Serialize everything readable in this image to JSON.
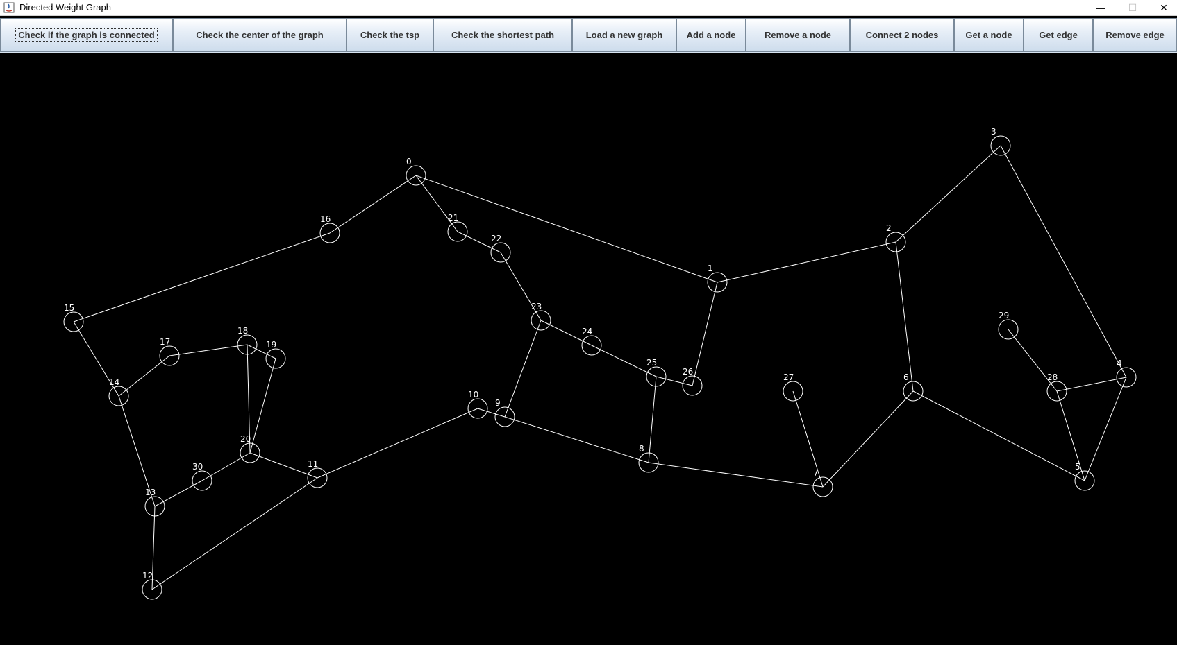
{
  "window": {
    "title": "Directed Weight Graph",
    "controls": {
      "minimize": "—",
      "maximize": "☐",
      "close": "✕"
    }
  },
  "toolbar": {
    "buttons": [
      {
        "id": "check-connected",
        "label": "Check if the graph is connected",
        "focused": true
      },
      {
        "id": "check-center",
        "label": "Check the center of the graph"
      },
      {
        "id": "check-tsp",
        "label": "Check the tsp"
      },
      {
        "id": "check-shortest-path",
        "label": "Check the shortest path"
      },
      {
        "id": "load-graph",
        "label": "Load a new graph"
      },
      {
        "id": "add-node",
        "label": "Add a node"
      },
      {
        "id": "remove-node",
        "label": "Remove a node"
      },
      {
        "id": "connect-nodes",
        "label": "Connect 2 nodes"
      },
      {
        "id": "get-node",
        "label": "Get a node"
      },
      {
        "id": "get-edge",
        "label": "Get edge"
      },
      {
        "id": "remove-edge",
        "label": "Remove edge"
      }
    ]
  },
  "graph": {
    "colors": {
      "background": "#000000",
      "stroke": "#ffffff"
    },
    "nodes": [
      "0",
      "1",
      "2",
      "3",
      "4",
      "5",
      "6",
      "7",
      "8",
      "9",
      "10",
      "11",
      "12",
      "13",
      "14",
      "15",
      "16",
      "17",
      "18",
      "19",
      "20",
      "21",
      "22",
      "23",
      "24",
      "25",
      "26",
      "27",
      "28",
      "29",
      "30"
    ],
    "edges": [
      [
        "0",
        "16"
      ],
      [
        "0",
        "21"
      ],
      [
        "0",
        "1"
      ],
      [
        "16",
        "15"
      ],
      [
        "15",
        "14"
      ],
      [
        "14",
        "17"
      ],
      [
        "17",
        "18"
      ],
      [
        "18",
        "19"
      ],
      [
        "18",
        "20"
      ],
      [
        "19",
        "20"
      ],
      [
        "14",
        "13"
      ],
      [
        "13",
        "30"
      ],
      [
        "30",
        "20"
      ],
      [
        "20",
        "11"
      ],
      [
        "13",
        "12"
      ],
      [
        "12",
        "11"
      ],
      [
        "11",
        "10"
      ],
      [
        "10",
        "9"
      ],
      [
        "9",
        "8"
      ],
      [
        "9",
        "23"
      ],
      [
        "21",
        "22"
      ],
      [
        "22",
        "23"
      ],
      [
        "23",
        "24"
      ],
      [
        "24",
        "25"
      ],
      [
        "25",
        "26"
      ],
      [
        "25",
        "8"
      ],
      [
        "26",
        "1"
      ],
      [
        "8",
        "7"
      ],
      [
        "27",
        "7"
      ],
      [
        "7",
        "6"
      ],
      [
        "6",
        "2"
      ],
      [
        "6",
        "5"
      ],
      [
        "1",
        "2"
      ],
      [
        "2",
        "3"
      ],
      [
        "3",
        "4"
      ],
      [
        "4",
        "28"
      ],
      [
        "4",
        "5"
      ],
      [
        "29",
        "28"
      ],
      [
        "28",
        "5"
      ]
    ]
  }
}
